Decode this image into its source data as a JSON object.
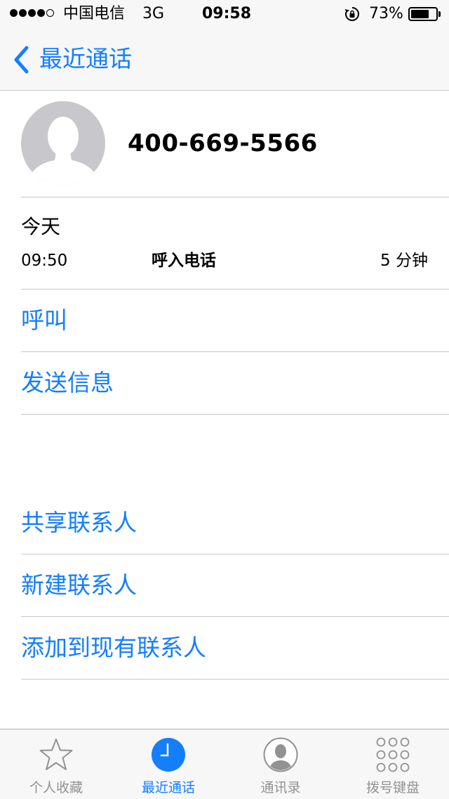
{
  "status_bar": {
    "carrier": "中国电信",
    "network": "3G",
    "time": "09:58",
    "battery_percent_text": "73%",
    "battery_level": 0.73,
    "signal_bars_filled": 4,
    "signal_bars_total": 5
  },
  "nav": {
    "back_label": "最近通话",
    "back_icon": "chevron-left-icon"
  },
  "contact": {
    "avatar_icon": "person-silhouette-icon",
    "phone_number": "400-669-5566"
  },
  "call_log": {
    "day": "今天",
    "time": "09:50",
    "type": "呼入电话",
    "duration": "5 分钟"
  },
  "actions": {
    "call": "呼叫",
    "send_message": "发送信息",
    "share_contact": "共享联系人",
    "new_contact": "新建联系人",
    "add_to_existing": "添加到现有联系人"
  },
  "tabs": [
    {
      "label": "个人收藏",
      "icon": "star-icon",
      "active": false
    },
    {
      "label": "最近通话",
      "icon": "clock-icon",
      "active": true
    },
    {
      "label": "通讯录",
      "icon": "contacts-icon",
      "active": false
    },
    {
      "label": "拨号键盘",
      "icon": "keypad-icon",
      "active": false
    }
  ],
  "colors": {
    "accent": "#157efb",
    "inactive_tab": "#929292",
    "separator": "#c8c7cc",
    "bar_background": "#f7f7f7"
  }
}
